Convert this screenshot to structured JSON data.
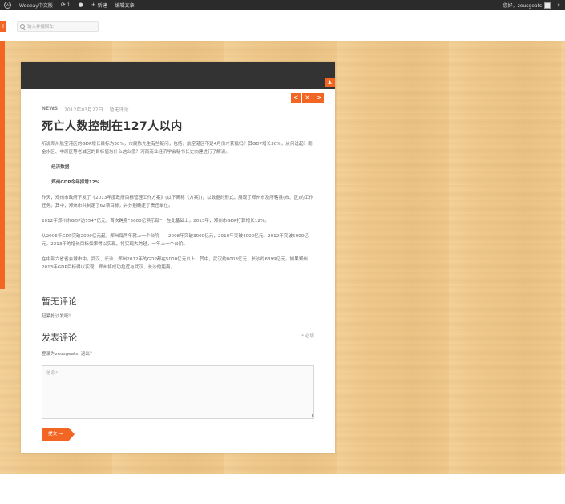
{
  "adminbar": {
    "wp_logo": "W",
    "site_name": "Woeeay中文版",
    "updates_count": "1",
    "new_label": "新建",
    "edit_label": "编辑文章",
    "greeting": "您好，zeusgeats"
  },
  "search": {
    "placeholder": "输入并搜回车"
  },
  "sidebar": {
    "plus": "+"
  },
  "card": {
    "up_arrow": "▲",
    "nav": {
      "prev": "<",
      "close": "×",
      "next": ">"
    }
  },
  "post": {
    "category": "NEWS",
    "date": "2012年03月27日",
    "comments_link": "暂无评论",
    "title": "死亡人数控制在127人以内",
    "paragraphs": [
      "听说郑州航空港区的GDP增长目标为30%，市民陈先生有些疑问，包括，航空港区不是4月份才获批吗？其GDP增长30%，从何说起？而金水区、中原区等老城区的目标值为什么这么低？河南商业经济学会秘书长史向建进行了解读。",
      "经济数据",
      "郑州GDP今年拟增12%",
      "昨天，郑州市政府下发了《2013年度政府目标管理工作方案》(以下简称《方案》)，以数据的形式，展现了郑州市及所辖县(市、区)的工作任务。其中，郑州市共制定了62项目标，并分别确定了责任单位。",
      "2012年郑州市GDP达5547亿元，首次跨身“5000亿俱乐部”，在此基础上，2013年，郑州市GDP打算增长12%。",
      "从2006年GDP突破2000亿元起，郑州每两年就上一个台阶——2008年突破3000亿元，2010年突破4000亿元，2012年突破5000亿元。2013年的增长目标如果得以实现，将实现大跨越，一年上一个台阶。",
      "在中部六省省会城市中，武汉、长沙、郑州2012年的GDP都在5000亿元以上。其中，武汉约8003亿元，长沙约6399亿元。如果郑州2013年GDP目标得以实现，郑州将成功拉近与武汉、长沙的距离。"
    ]
  },
  "comments": {
    "heading": "暂无评论",
    "empty_tip": "赶紧抢沙发吧！",
    "reply_heading": "发表评论",
    "required_note": "* 必填",
    "logged_in": "登录为zeusgeats. 退出？",
    "textarea_placeholder": "信息*",
    "submit_label": "提交 →"
  }
}
